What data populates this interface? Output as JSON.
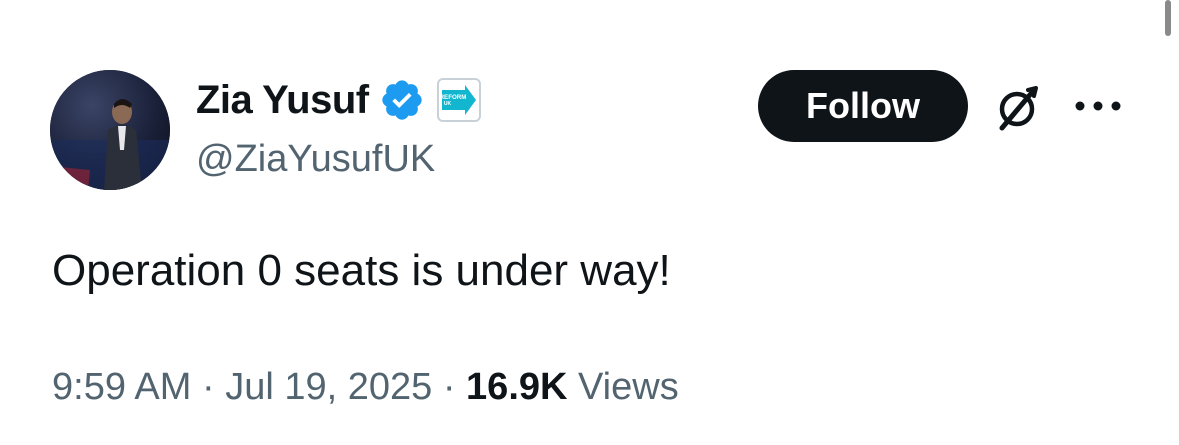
{
  "author": {
    "display_name": "Zia Yusuf",
    "handle": "@ZiaYusufUK",
    "verified": true,
    "affiliate_badge_text": [
      "REFORM",
      "UK"
    ]
  },
  "actions": {
    "follow_label": "Follow"
  },
  "tweet": {
    "text": "Operation 0 seats is under way!"
  },
  "meta": {
    "time": "9:59 AM",
    "separator": "·",
    "date": "Jul 19, 2025",
    "views_count": "16.9K",
    "views_label": "Views"
  },
  "colors": {
    "text_primary": "#0f1419",
    "text_secondary": "#536471",
    "verified_blue": "#1d9bf0",
    "reform_teal": "#12b6cf",
    "button_bg": "#0f1419"
  },
  "icons": {
    "verified": "verified-badge-icon",
    "affiliate": "reform-uk-logo",
    "grok": "grok-icon",
    "more": "more-horizontal-icon"
  }
}
